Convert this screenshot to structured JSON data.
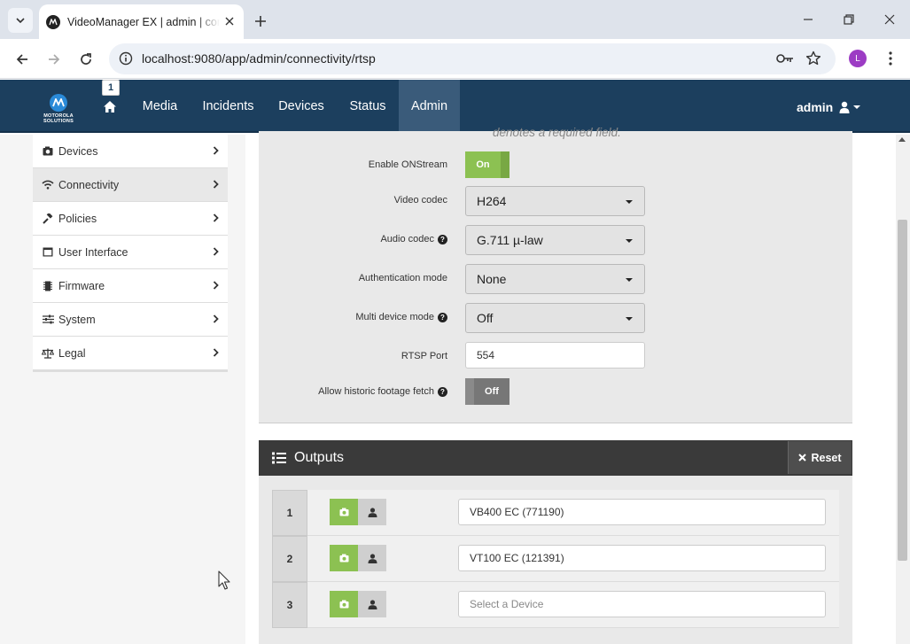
{
  "browser": {
    "tab_title": "VideoManager EX | admin | connectivity",
    "url": "localhost:9080/app/admin/connectivity/rtsp",
    "profile_initial": "L"
  },
  "appnav": {
    "logo_text": "MOTOROLA SOLUTIONS",
    "home_badge": "1",
    "items": [
      "Media",
      "Incidents",
      "Devices",
      "Status",
      "Admin"
    ],
    "active_item": "Admin",
    "user": "admin"
  },
  "sidebar": {
    "items": [
      {
        "label": "Devices",
        "icon": "camera-icon"
      },
      {
        "label": "Connectivity",
        "icon": "wifi-icon",
        "active": true
      },
      {
        "label": "Policies",
        "icon": "gavel-icon"
      },
      {
        "label": "User Interface",
        "icon": "window-icon"
      },
      {
        "label": "Firmware",
        "icon": "chip-icon"
      },
      {
        "label": "System",
        "icon": "sliders-icon"
      },
      {
        "label": "Legal",
        "icon": "balance-scale-icon"
      }
    ]
  },
  "form": {
    "required_note": "denotes a required field.",
    "enable_onstream": {
      "label": "Enable ONStream",
      "value": "On"
    },
    "video_codec": {
      "label": "Video codec",
      "value": "H264"
    },
    "audio_codec": {
      "label": "Audio codec",
      "value": "G.711 µ-law"
    },
    "auth_mode": {
      "label": "Authentication mode",
      "value": "None"
    },
    "multi_device": {
      "label": "Multi device mode",
      "value": "Off"
    },
    "rtsp_port": {
      "label": "RTSP Port",
      "value": "554"
    },
    "historic_fetch": {
      "label": "Allow historic footage fetch",
      "value": "Off"
    }
  },
  "outputs": {
    "title": "Outputs",
    "reset_label": "Reset",
    "rows": [
      {
        "num": "1",
        "device": "VB400 EC (771190)"
      },
      {
        "num": "2",
        "device": "VT100 EC (121391)"
      },
      {
        "num": "3",
        "device": "",
        "placeholder": "Select a Device"
      }
    ]
  },
  "colors": {
    "navbar": "#1c3f5e",
    "toggle_on": "#8cc152",
    "toggle_off": "#8a8a8a",
    "outputs_header": "#3a3a3a"
  }
}
